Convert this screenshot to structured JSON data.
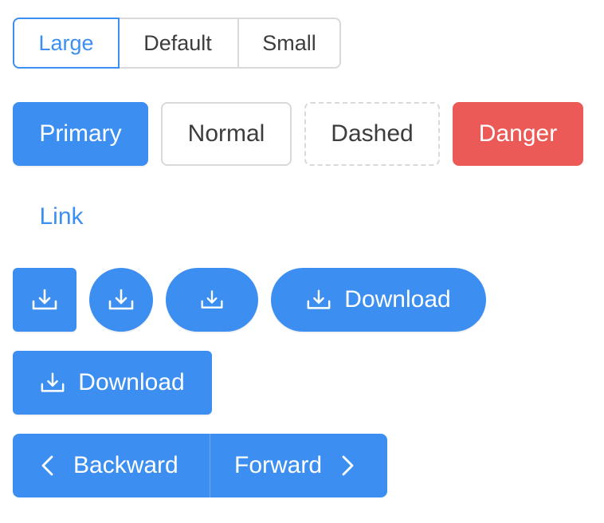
{
  "size_group": {
    "large_label": "Large",
    "default_label": "Default",
    "small_label": "Small",
    "selected": "Large"
  },
  "type_row": {
    "primary_label": "Primary",
    "normal_label": "Normal",
    "dashed_label": "Dashed",
    "danger_label": "Danger",
    "link_label": "Link"
  },
  "icon_row": {
    "download_label": "Download",
    "icon": "download-icon"
  },
  "download_block": {
    "label": "Download",
    "icon": "download-icon"
  },
  "nav_group": {
    "backward_label": "Backward",
    "forward_label": "Forward",
    "backward_icon": "chevron-left-icon",
    "forward_icon": "chevron-right-icon"
  },
  "colors": {
    "primary": "#3c8ff0",
    "danger": "#eb5a57",
    "border": "#d9d9d9",
    "text": "#3d3d3d"
  }
}
